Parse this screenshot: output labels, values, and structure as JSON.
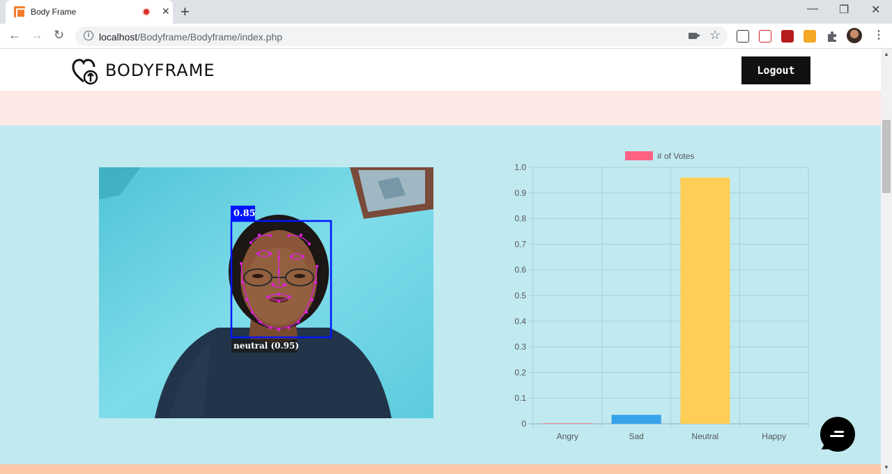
{
  "browser": {
    "tab_title": "Body Frame",
    "tab_close": "✕",
    "new_tab": "+",
    "url_host": "localhost",
    "url_path": "/Bodyframe/Bodyframe/index.php",
    "window_minimize": "—",
    "window_restore": "❐",
    "window_close": "✕",
    "back": "←",
    "forward": "→",
    "reload": "↻",
    "star": "☆",
    "menu": "⋮"
  },
  "header": {
    "brand": "BODYFRAME",
    "logout_label": "Logout"
  },
  "detection": {
    "face_score": "0.85",
    "expression_label": "neutral (0.95)"
  },
  "chart_data": {
    "type": "bar",
    "categories": [
      "Angry",
      "Sad",
      "Neutral",
      "Happy"
    ],
    "series": [
      {
        "name": "# of Votes",
        "values": [
          0.002,
          0.035,
          0.96,
          0.0
        ]
      }
    ],
    "bar_colors": [
      "#ff6384",
      "#36a2eb",
      "#ffce56",
      "#4bc0c0"
    ],
    "legend_color": "#ff6384",
    "ylim": [
      0,
      1.0
    ],
    "yticks": [
      "1.0",
      "0.9",
      "0.8",
      "0.7",
      "0.6",
      "0.5",
      "0.4",
      "0.3",
      "0.2",
      "0.1",
      "0"
    ],
    "grid": true,
    "legend_position": "top"
  },
  "colors": {
    "band_pink": "#fde8e6",
    "band_blue": "#c0eaf0",
    "band_orange": "#fbc9a8",
    "landmark": "#e020e0",
    "box": "#0015ff"
  }
}
